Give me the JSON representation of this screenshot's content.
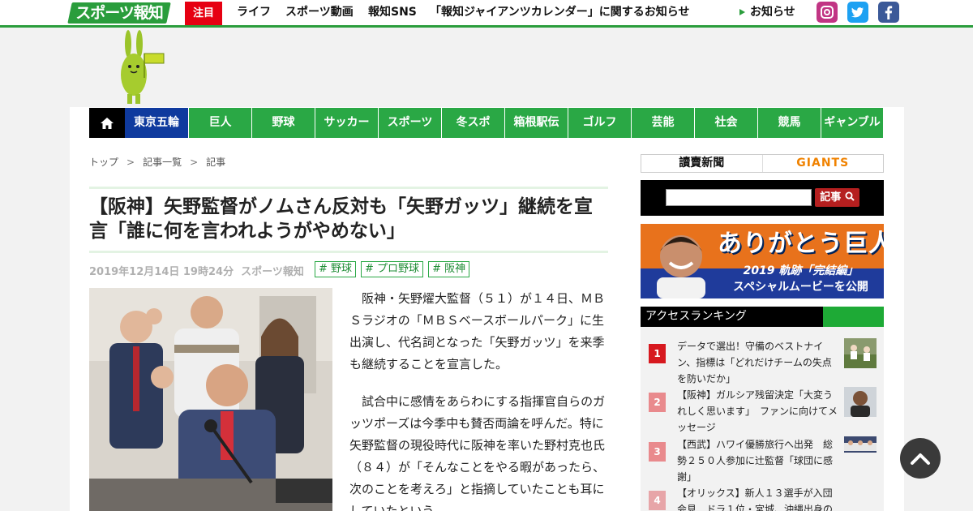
{
  "header": {
    "logo_text": "スポーツ報知",
    "hot_badge": "注目",
    "nav_links": [
      "ライフ",
      "スポーツ動画",
      "報知SNS",
      "「報知ジャイアンツカレンダー」に関するお知らせ"
    ],
    "notice_label": "お知らせ",
    "sns": [
      "instagram-icon",
      "twitter-icon",
      "facebook-icon"
    ]
  },
  "category_nav": {
    "home_icon": "home-icon",
    "items": [
      "東京五輪",
      "巨人",
      "野球",
      "サッカー",
      "スポーツ",
      "冬スポ",
      "箱根駅伝",
      "ゴルフ",
      "芸能",
      "社会",
      "競馬",
      "ギャンブル"
    ]
  },
  "breadcrumb": [
    "トップ",
    "記事一覧",
    "記事"
  ],
  "article": {
    "headline": "【阪神】矢野監督がノムさん反対も「矢野ガッツ」継続を宣言「誰に何を言われようがやめない」",
    "date": "2019年12月14日 19時24分",
    "source": "スポーツ報知",
    "tags": [
      "# 野球",
      "# プロ野球",
      "# 阪神"
    ],
    "paragraphs": [
      "阪神・矢野燿大監督（５１）が１４日、ＭＢＳラジオの「ＭＢＳベースボールパーク」に生出演し、代名詞となった「矢野ガッツ」を来季も継続することを宣言した。",
      "試合中に感情をあらわにする指揮官自らのガッツポーズは今季中も賛否両論を呼んだ。特に矢野監督の現役時代に阪神を率いた野村克也氏（８４）が「そんなことをやる暇があったら、次のことを考えろ」と指摘していたことも耳にしていたという。"
    ]
  },
  "sidebar": {
    "partners": [
      "讀賣新聞",
      "GIANTS"
    ],
    "search_button": "記事",
    "search_placeholder": "",
    "banner": {
      "title": "ありがとう巨人",
      "line1": "2019 軌跡「完結編」",
      "line2": "スペシャルムービーを公開"
    },
    "ranking_title": "アクセスランキング",
    "ranking": [
      {
        "rank": "1",
        "text": "データで選出！守備のベストナイン、指標は「どれだけチームの失点を防いだか」",
        "color": "#d7191f"
      },
      {
        "rank": "2",
        "text": "【阪神】ガルシア残留決定「大変うれしく思います」　ファンに向けてメッセージ",
        "color": "#e98a8d"
      },
      {
        "rank": "3",
        "text": "【西武】ハワイ優勝旅行へ出発　総勢２５０人参加に辻監督「球団に感謝」",
        "color": "#e98a8d"
      },
      {
        "rank": "4",
        "text": "【オリックス】新人１３選手が入団会見　ドラ１位・宮城、沖縄出身の",
        "color": "#e7a5a8"
      }
    ]
  },
  "colors": {
    "brand_green": "#2a9d3c",
    "nav_green": "#2aa845",
    "nav_blue": "#0f3a9e",
    "hot_red": "#e60012"
  }
}
